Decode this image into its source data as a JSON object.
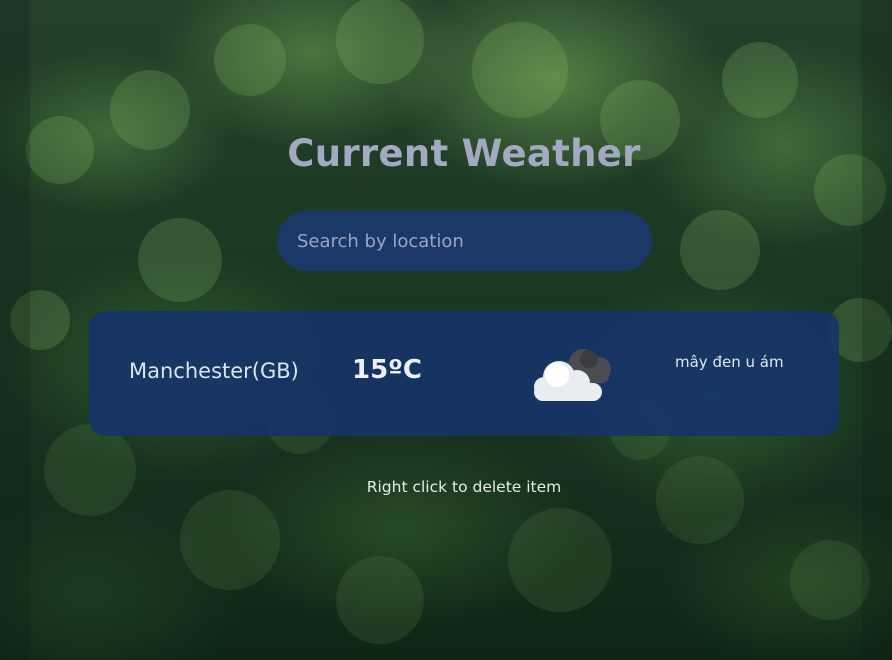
{
  "header": {
    "title": "Current Weather"
  },
  "search": {
    "placeholder": "Search by location",
    "value": ""
  },
  "weather_items": [
    {
      "location": "Manchester(GB)",
      "temperature": "15ºC",
      "icon": "broken-clouds-icon",
      "description": "mây đen u ám"
    }
  ],
  "hint": {
    "text": "Right click to delete item"
  },
  "colors": {
    "title": "#a3a9c3",
    "card_background": "#163468",
    "search_background": "#1b386e",
    "text_light": "#dde3f0"
  }
}
